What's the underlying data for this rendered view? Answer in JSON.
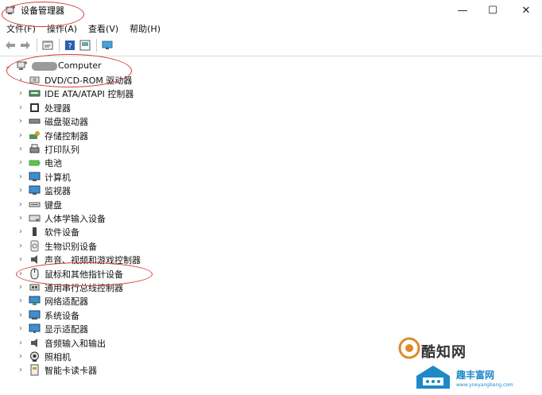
{
  "window": {
    "title": "设备管理器",
    "controls": {
      "minimize": "—",
      "maximize": "☐",
      "close": "✕"
    }
  },
  "menu": [
    "文件(F)",
    "操作(A)",
    "查看(V)",
    "帮助(H)"
  ],
  "tree": {
    "root": "Computer",
    "items": [
      {
        "label": "DVD/CD-ROM 驱动器",
        "icon": "disc-drive-icon"
      },
      {
        "label": "IDE ATA/ATAPI 控制器",
        "icon": "ide-controller-icon"
      },
      {
        "label": "处理器",
        "icon": "processor-icon"
      },
      {
        "label": "磁盘驱动器",
        "icon": "disk-drive-icon"
      },
      {
        "label": "存储控制器",
        "icon": "storage-controller-icon"
      },
      {
        "label": "打印队列",
        "icon": "printer-icon"
      },
      {
        "label": "电池",
        "icon": "battery-icon"
      },
      {
        "label": "计算机",
        "icon": "computer-icon"
      },
      {
        "label": "监视器",
        "icon": "monitor-icon"
      },
      {
        "label": "键盘",
        "icon": "keyboard-icon"
      },
      {
        "label": "人体学输入设备",
        "icon": "hid-icon"
      },
      {
        "label": "软件设备",
        "icon": "software-device-icon"
      },
      {
        "label": "生物识别设备",
        "icon": "biometric-icon"
      },
      {
        "label": "声音、视频和游戏控制器",
        "icon": "sound-icon"
      },
      {
        "label": "鼠标和其他指针设备",
        "icon": "mouse-icon"
      },
      {
        "label": "通用串行总线控制器",
        "icon": "usb-icon"
      },
      {
        "label": "网络适配器",
        "icon": "network-adapter-icon"
      },
      {
        "label": "系统设备",
        "icon": "system-device-icon"
      },
      {
        "label": "显示适配器",
        "icon": "display-adapter-icon"
      },
      {
        "label": "音频输入和输出",
        "icon": "audio-io-icon"
      },
      {
        "label": "照相机",
        "icon": "camera-icon"
      },
      {
        "label": "智能卡读卡器",
        "icon": "smart-card-reader-icon"
      }
    ]
  },
  "watermark": {
    "line1": "酷知网",
    "line2": "趣丰富网",
    "line3": "www.yneyangbang.com"
  },
  "colors": {
    "annotation": "#d43a3a",
    "accent": "#1e88c8"
  }
}
